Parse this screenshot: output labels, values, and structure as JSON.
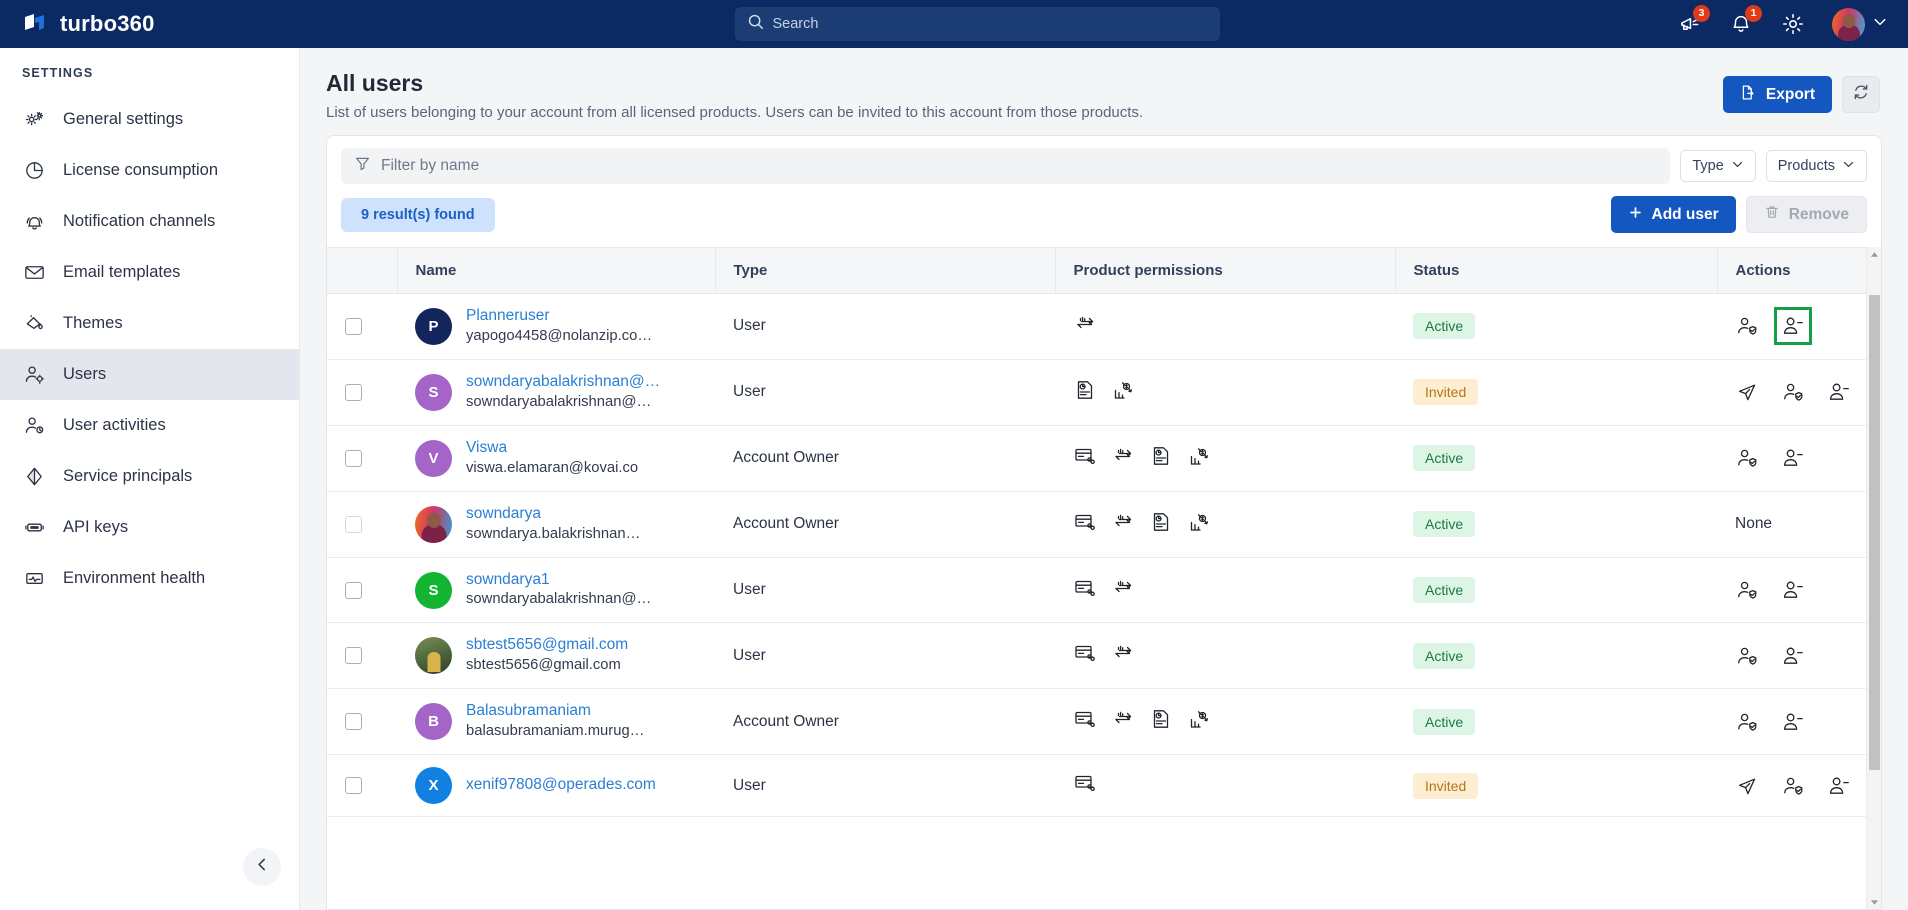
{
  "topbar": {
    "brand": "turbo360",
    "logo_icon": "turbo360-logo-icon",
    "search": {
      "placeholder": "Search",
      "value": "",
      "icon": "search-icon"
    },
    "announcements": {
      "icon": "megaphone-icon",
      "badge": "3"
    },
    "notifications": {
      "icon": "bell-icon",
      "badge": "1"
    },
    "settings": {
      "icon": "gear-icon"
    },
    "profile": {
      "icon": "avatar",
      "chevron": "chevron-down-icon"
    }
  },
  "sidebar": {
    "title": "SETTINGS",
    "collapse_icon": "chevron-left-icon",
    "items": [
      {
        "label": "General settings",
        "icon": "gears-icon",
        "active": false
      },
      {
        "label": "License consumption",
        "icon": "pie-chart-icon",
        "active": false
      },
      {
        "label": "Notification channels",
        "icon": "bell-channels-icon",
        "active": false
      },
      {
        "label": "Email templates",
        "icon": "envelope-icon",
        "active": false
      },
      {
        "label": "Themes",
        "icon": "paint-bucket-icon",
        "active": false
      },
      {
        "label": "Users",
        "icon": "user-gear-icon",
        "active": true
      },
      {
        "label": "User activities",
        "icon": "user-clock-icon",
        "active": false
      },
      {
        "label": "Service principals",
        "icon": "diamond-icon",
        "active": false
      },
      {
        "label": "API keys",
        "icon": "key-card-icon",
        "active": false
      },
      {
        "label": "Environment health",
        "icon": "pulse-icon",
        "active": false
      }
    ]
  },
  "page": {
    "title": "All users",
    "subtitle": "List of users belonging to your account from all licensed products. Users can be invited to this account from those products.",
    "export_label": "Export",
    "export_icon": "file-export-icon",
    "refresh_icon": "refresh-icon"
  },
  "toolbar": {
    "filter": {
      "placeholder": "Filter by name",
      "value": "",
      "icon": "filter-icon"
    },
    "type_dropdown": {
      "label": "Type",
      "icon": "chevron-down-icon"
    },
    "products_dropdown": {
      "label": "Products",
      "icon": "chevron-down-icon"
    },
    "results_chip": "9 result(s) found",
    "add_user_label": "Add user",
    "add_user_icon": "plus-icon",
    "remove_label": "Remove",
    "remove_icon": "trash-icon",
    "remove_disabled": true
  },
  "table": {
    "columns": [
      "Name",
      "Type",
      "Product permissions",
      "Status",
      "Actions"
    ],
    "rows": [
      {
        "name": "Planneruser",
        "email": "yapogo4458@nolanzip.co…",
        "avatar_text": "P",
        "avatar_color": "#13265c",
        "avatar_kind": "initial",
        "type": "User",
        "permissions": [
          "exchange-icon"
        ],
        "status": "Active",
        "status_kind": "active",
        "actions": [
          "manage-permissions-icon",
          "remove-user-icon"
        ],
        "highlight_action_index": 1,
        "checkbox_disabled": false
      },
      {
        "name": "sowndaryabalakrishnan@…",
        "email": "sowndaryabalakrishnan@…",
        "avatar_text": "S",
        "avatar_color": "#a464c8",
        "avatar_kind": "initial",
        "type": "User",
        "permissions": [
          "report-icon",
          "cost-analysis-icon"
        ],
        "status": "Invited",
        "status_kind": "invited",
        "actions": [
          "resend-invite-icon",
          "manage-permissions-icon",
          "remove-user-icon"
        ],
        "highlight_action_index": -1,
        "checkbox_disabled": false
      },
      {
        "name": "Viswa",
        "email": "viswa.elamaran@kovai.co",
        "avatar_text": "V",
        "avatar_color": "#a464c8",
        "avatar_kind": "initial",
        "type": "Account Owner",
        "permissions": [
          "integrate-icon",
          "exchange-icon",
          "report-icon",
          "cost-analysis-icon"
        ],
        "status": "Active",
        "status_kind": "active",
        "actions": [
          "manage-permissions-icon",
          "remove-user-icon"
        ],
        "highlight_action_index": -1,
        "checkbox_disabled": false
      },
      {
        "name": "sowndarya",
        "email": "sowndarya.balakrishnan…",
        "avatar_text": "",
        "avatar_color": "",
        "avatar_kind": "photo-a",
        "type": "Account Owner",
        "permissions": [
          "integrate-icon",
          "exchange-icon",
          "report-icon",
          "cost-analysis-icon"
        ],
        "status": "Active",
        "status_kind": "active",
        "actions": [],
        "actions_none_text": "None",
        "highlight_action_index": -1,
        "checkbox_disabled": true
      },
      {
        "name": "sowndarya1",
        "email": "sowndaryabalakrishnan@…",
        "avatar_text": "S",
        "avatar_color": "#12b431",
        "avatar_kind": "initial",
        "type": "User",
        "permissions": [
          "integrate-icon",
          "exchange-icon"
        ],
        "status": "Active",
        "status_kind": "active",
        "actions": [
          "manage-permissions-icon",
          "remove-user-icon"
        ],
        "highlight_action_index": -1,
        "checkbox_disabled": false
      },
      {
        "name": "sbtest5656@gmail.com",
        "email": "sbtest5656@gmail.com",
        "avatar_text": "",
        "avatar_color": "",
        "avatar_kind": "photo-b",
        "type": "User",
        "permissions": [
          "integrate-icon",
          "exchange-icon"
        ],
        "status": "Active",
        "status_kind": "active",
        "actions": [
          "manage-permissions-icon",
          "remove-user-icon"
        ],
        "highlight_action_index": -1,
        "checkbox_disabled": false
      },
      {
        "name": "Balasubramaniam",
        "email": "balasubramaniam.murug…",
        "avatar_text": "B",
        "avatar_color": "#a464c8",
        "avatar_kind": "initial",
        "type": "Account Owner",
        "permissions": [
          "integrate-icon",
          "exchange-icon",
          "report-icon",
          "cost-analysis-icon"
        ],
        "status": "Active",
        "status_kind": "active",
        "actions": [
          "manage-permissions-icon",
          "remove-user-icon"
        ],
        "highlight_action_index": -1,
        "checkbox_disabled": false
      },
      {
        "name": "xenif97808@operades.com",
        "email": "",
        "avatar_text": "X",
        "avatar_color": "#1180e0",
        "avatar_kind": "initial",
        "type": "User",
        "permissions": [
          "integrate-icon"
        ],
        "status": "Invited",
        "status_kind": "invited",
        "actions": [
          "resend-invite-icon",
          "manage-permissions-icon",
          "remove-user-icon"
        ],
        "highlight_action_index": -1,
        "checkbox_disabled": false
      }
    ]
  },
  "colors": {
    "topbar_bg": "#0b2a63",
    "primary": "#1557c0",
    "link": "#2a7fd4",
    "active_badge": "#1a7a43",
    "invited_badge": "#b57516",
    "highlight_outline": "#12a148"
  }
}
